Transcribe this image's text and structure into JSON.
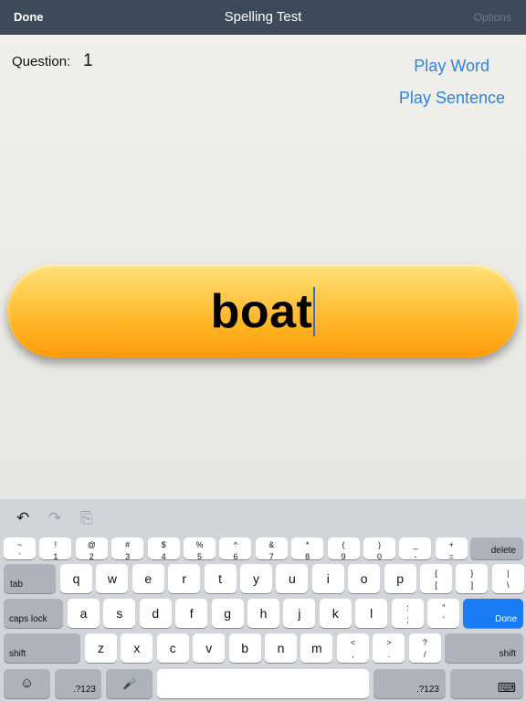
{
  "nav": {
    "done": "Done",
    "title": "Spelling Test",
    "options": "Options"
  },
  "question": {
    "label": "Question:",
    "number": "1"
  },
  "buttons": {
    "play_word": "Play Word",
    "play_sentence": "Play Sentence"
  },
  "answer": {
    "text": "boat"
  },
  "keyboard": {
    "tools": {
      "undo": "↶",
      "redo": "↷",
      "paste": "⎘"
    },
    "number_row": [
      [
        "~",
        "`"
      ],
      [
        "!",
        "1"
      ],
      [
        "@",
        "2"
      ],
      [
        "#",
        "3"
      ],
      [
        "$",
        "4"
      ],
      [
        "%",
        "5"
      ],
      [
        "^",
        "6"
      ],
      [
        "&",
        "7"
      ],
      [
        "*",
        "8"
      ],
      [
        "(",
        "9"
      ],
      [
        ")",
        "0"
      ],
      [
        "_",
        "-"
      ],
      [
        "+",
        "="
      ]
    ],
    "delete": "delete",
    "tab": "tab",
    "row_q": [
      "q",
      "w",
      "e",
      "r",
      "t",
      "y",
      "u",
      "i",
      "o",
      "p"
    ],
    "row_q_extra": [
      [
        "{",
        "["
      ],
      [
        "}",
        "]"
      ],
      [
        "|",
        "\\"
      ]
    ],
    "caps": "caps lock",
    "row_a": [
      "a",
      "s",
      "d",
      "f",
      "g",
      "h",
      "j",
      "k",
      "l"
    ],
    "row_a_extra": [
      [
        ":",
        ";"
      ],
      [
        "\"",
        "'"
      ]
    ],
    "done": "Done",
    "shift": "shift",
    "row_z": [
      "z",
      "x",
      "c",
      "v",
      "b",
      "n",
      "m"
    ],
    "row_z_extra": [
      [
        "<",
        ","
      ],
      [
        ">",
        "."
      ],
      [
        "?",
        "/"
      ]
    ],
    "emoji": "☺",
    "num_left": ".?123",
    "mic": "🎤",
    "num_right": ".?123",
    "hide": "⌨"
  }
}
